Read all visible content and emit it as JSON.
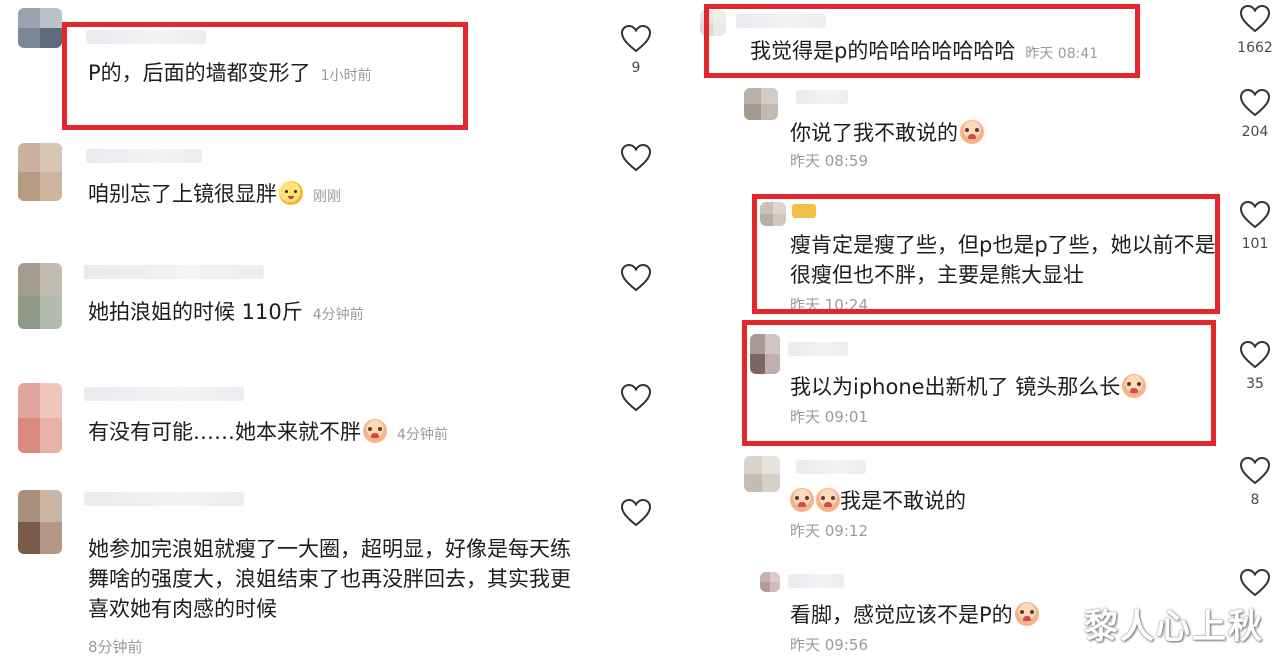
{
  "left": {
    "comments": [
      {
        "text": "P的，后面的墙都变形了",
        "time": "1小时前",
        "likes": "9"
      },
      {
        "text": "咱别忘了上镜很显胖",
        "time": "刚刚",
        "likes": ""
      },
      {
        "text": "她拍浪姐的时候 110斤",
        "time": "4分钟前",
        "likes": ""
      },
      {
        "text": "有没有可能……她本来就不胖",
        "time": "4分钟前",
        "likes": ""
      },
      {
        "text": "她参加完浪姐就瘦了一大圈，超明显，好像是每天练舞啥的强度大，浪姐结束了也再没胖回去，其实我更喜欢她有肉感的时候",
        "time": "8分钟前",
        "likes": ""
      }
    ]
  },
  "right": {
    "comments": [
      {
        "text": "我觉得是p的哈哈哈哈哈哈哈",
        "time": "昨天 08:41",
        "likes": "1662"
      },
      {
        "text": "你说了我不敢说的",
        "time": "昨天 08:59",
        "likes": "204"
      },
      {
        "text": "瘦肯定是瘦了些，但p也是p了些，她以前不是很瘦但也不胖，主要是熊大显壮",
        "time": "昨天 10:24",
        "likes": "101"
      },
      {
        "text": "我以为iphone出新机了 镜头那么长",
        "time": "昨天 09:01",
        "likes": "35"
      },
      {
        "text": "我是不敢说的",
        "time": "昨天 09:12",
        "likes": "8"
      },
      {
        "text": "看脚，感觉应该不是P的",
        "time": "昨天 09:56",
        "likes": ""
      }
    ]
  },
  "watermark": "黎人心上秋",
  "colors": {
    "highlight": "#e3262b",
    "meta": "#9a9aa2"
  },
  "icons": {
    "like": "heart-outline-icon",
    "emoji_sad": "crying-face-emoji",
    "emoji_mango": "mango-face-emoji"
  }
}
